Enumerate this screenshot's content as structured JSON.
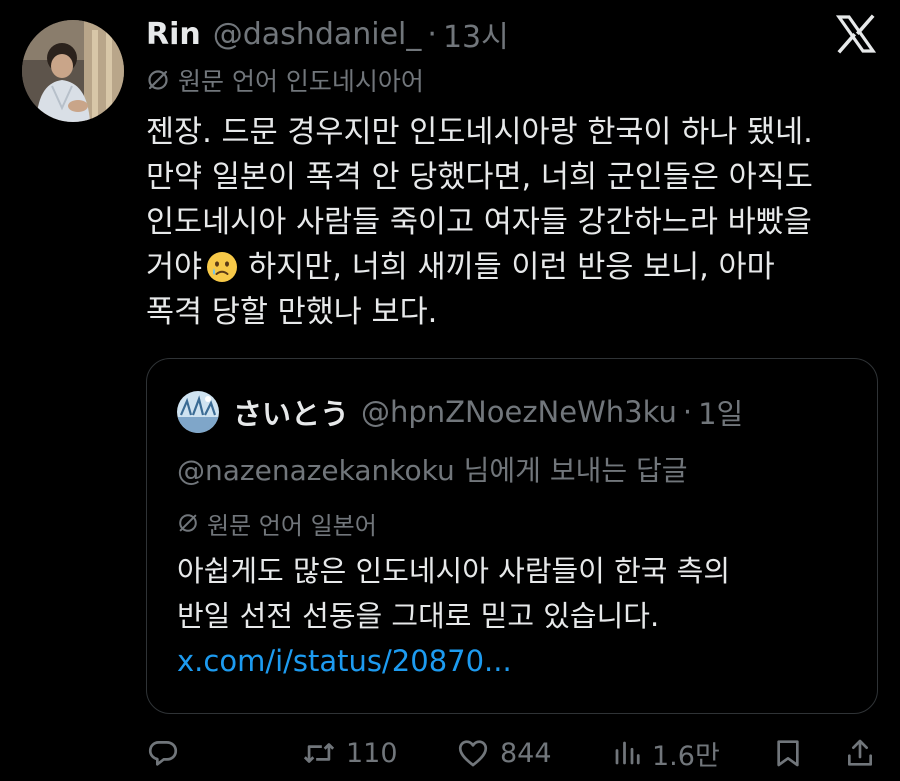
{
  "tweet": {
    "author_name": "Rin",
    "author_handle": "@dashdaniel_",
    "separator": "·",
    "timestamp": "13시",
    "original_language_label": "원문 언어 인도네시아어",
    "body_lines": [
      "젠장. 드문 경우지만 인도네시아랑 한국이 하나 됐네.",
      "만약 일본이 폭격 안 당했다면, 너희 군인들은 아직도",
      "인도네시아 사람들 죽이고 여자들 강간하느라 바빴을",
      "거야",
      "하지만, 너희 새끼들 이런 반응 보니, 아마",
      "폭격 당할 만했나 보다."
    ],
    "emoji": "crying-face-emoji"
  },
  "quote": {
    "author_name": "さいとう",
    "author_handle": "@hpnZNoezNeWh3ku",
    "separator": "·",
    "timestamp": "1일",
    "replying_to_handle": "@nazenazekankoku",
    "replying_to_suffix": " 님에게 보내는 답글",
    "original_language_label": "원문 언어 일본어",
    "body_lines": [
      "아쉽게도 많은 인도네시아 사람들이 한국 측의",
      "반일 선전 선동을 그대로 믿고 있습니다."
    ],
    "link_text": "x.com/i/status/20870..."
  },
  "actions": {
    "reply_count": "",
    "retweet_count": "110",
    "like_count": "844",
    "views_count": "1.6만"
  },
  "icons": {
    "reply": "reply-icon",
    "retweet": "retweet-icon",
    "like": "heart-icon",
    "views": "views-icon",
    "bookmark": "bookmark-icon",
    "share": "share-icon",
    "translate": "translate-icon",
    "logo": "x-logo-icon"
  },
  "colors": {
    "background": "#000000",
    "text": "#e7e9ea",
    "secondary_text": "#71767b",
    "link": "#1d9bf0",
    "border": "#2f3336"
  }
}
